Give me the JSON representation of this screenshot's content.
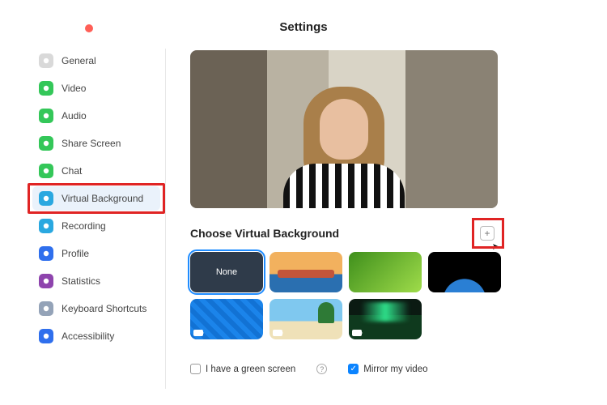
{
  "title": "Settings",
  "sidebar": {
    "items": [
      {
        "label": "General",
        "icon": "gear-icon",
        "color": "#d9d9d9"
      },
      {
        "label": "Video",
        "icon": "video-icon",
        "color": "#34c759"
      },
      {
        "label": "Audio",
        "icon": "audio-icon",
        "color": "#34c759"
      },
      {
        "label": "Share Screen",
        "icon": "share-screen-icon",
        "color": "#34c759"
      },
      {
        "label": "Chat",
        "icon": "chat-icon",
        "color": "#34c759"
      },
      {
        "label": "Virtual Background",
        "icon": "virtual-background-icon",
        "color": "#2aa8e0",
        "active": true,
        "highlight": true
      },
      {
        "label": "Recording",
        "icon": "recording-icon",
        "color": "#2aa8e0"
      },
      {
        "label": "Profile",
        "icon": "profile-icon",
        "color": "#2f6fed"
      },
      {
        "label": "Statistics",
        "icon": "statistics-icon",
        "color": "#8e44ad"
      },
      {
        "label": "Keyboard Shortcuts",
        "icon": "keyboard-icon",
        "color": "#94a3b8"
      },
      {
        "label": "Accessibility",
        "icon": "accessibility-icon",
        "color": "#2f6fed"
      }
    ]
  },
  "main": {
    "section_title": "Choose Virtual Background",
    "add_button_highlight": true,
    "thumbnails": [
      {
        "id": "none",
        "label": "None",
        "selected": true
      },
      {
        "id": "golden-gate"
      },
      {
        "id": "grass"
      },
      {
        "id": "earth"
      },
      {
        "id": "blue-pattern",
        "has_video_icon": true
      },
      {
        "id": "beach",
        "has_video_icon": true
      },
      {
        "id": "aurora",
        "has_video_icon": true
      }
    ],
    "options": {
      "green_screen": {
        "label": "I have a green screen",
        "checked": false
      },
      "mirror": {
        "label": "Mirror my video",
        "checked": true
      }
    },
    "help_glyph": "?"
  }
}
